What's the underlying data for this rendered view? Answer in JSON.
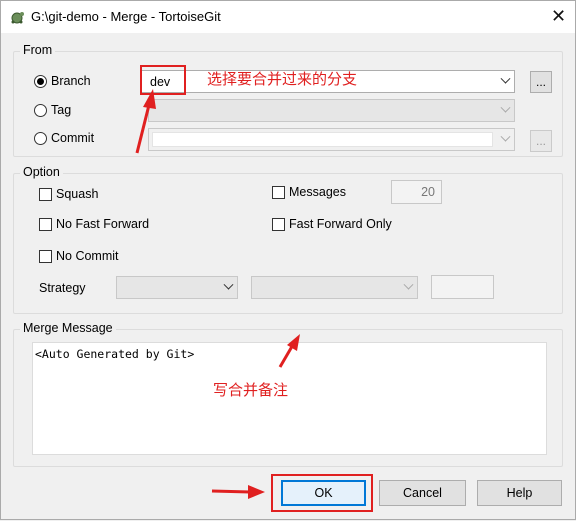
{
  "window": {
    "title": "G:\\git-demo - Merge - TortoiseGit",
    "close_glyph": "✕",
    "icon": "tortoisegit-icon"
  },
  "from": {
    "group_label": "From",
    "branch_label": "Branch",
    "branch_value": "dev",
    "tag_label": "Tag",
    "commit_label": "Commit",
    "browse_glyph": "...",
    "selected": "Branch"
  },
  "option": {
    "group_label": "Option",
    "squash_label": "Squash",
    "no_fast_forward_label": "No Fast Forward",
    "no_commit_label": "No Commit",
    "messages_label": "Messages",
    "messages_value": "20",
    "fast_forward_only_label": "Fast Forward Only",
    "strategy_label": "Strategy"
  },
  "merge_message": {
    "group_label": "Merge Message",
    "text": "<Auto Generated by Git>"
  },
  "buttons": {
    "ok": "OK",
    "cancel": "Cancel",
    "help": "Help"
  },
  "annotations": {
    "select_branch": "选择要合并过来的分支",
    "write_note": "写合并备注",
    "color": "#e02020"
  }
}
